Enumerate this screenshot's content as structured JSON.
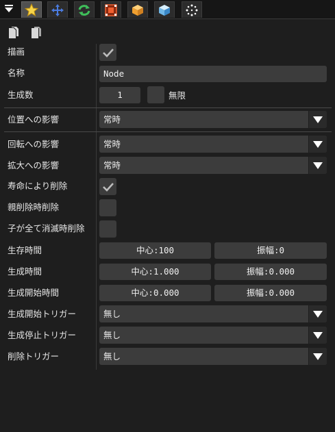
{
  "tabs": [
    {
      "icon": "star-icon",
      "active": true
    },
    {
      "icon": "move-arrows-icon",
      "active": false
    },
    {
      "icon": "rotate-icon",
      "active": false
    },
    {
      "icon": "scale-frame-icon",
      "active": false
    },
    {
      "icon": "box-icon",
      "active": false
    },
    {
      "icon": "cube-icon",
      "active": false
    },
    {
      "icon": "particles-icon",
      "active": false
    }
  ],
  "properties": {
    "draw_label": "描画",
    "draw_checked": true,
    "name_label": "名称",
    "name_value": "Node",
    "count_label": "生成数",
    "count_value": "1",
    "infinite_label": "無限",
    "infinite_checked": false,
    "position_label": "位置への影響",
    "position_value": "常時",
    "rotation_label": "回転への影響",
    "rotation_value": "常時",
    "scale_label": "拡大への影響",
    "scale_value": "常時",
    "remove_on_life_label": "寿命により削除",
    "remove_on_life_checked": true,
    "remove_on_parent_label": "親削除時削除",
    "remove_on_parent_checked": false,
    "remove_on_children_label": "子が全て消滅時削除",
    "remove_on_children_checked": false,
    "life_label": "生存時間",
    "life_center": "中心:100",
    "life_amplitude": "振幅:0",
    "gen_time_label": "生成時間",
    "gen_time_center": "中心:1.000",
    "gen_time_amplitude": "振幅:0.000",
    "gen_start_label": "生成開始時間",
    "gen_start_center": "中心:0.000",
    "gen_start_amplitude": "振幅:0.000",
    "start_trigger_label": "生成開始トリガー",
    "start_trigger_value": "無し",
    "stop_trigger_label": "生成停止トリガー",
    "stop_trigger_value": "無し",
    "remove_trigger_label": "削除トリガー",
    "remove_trigger_value": "無し"
  },
  "colors": {
    "background": "#1e1e1e",
    "field": "#3c3c3c",
    "text": "#e6e6e6"
  }
}
